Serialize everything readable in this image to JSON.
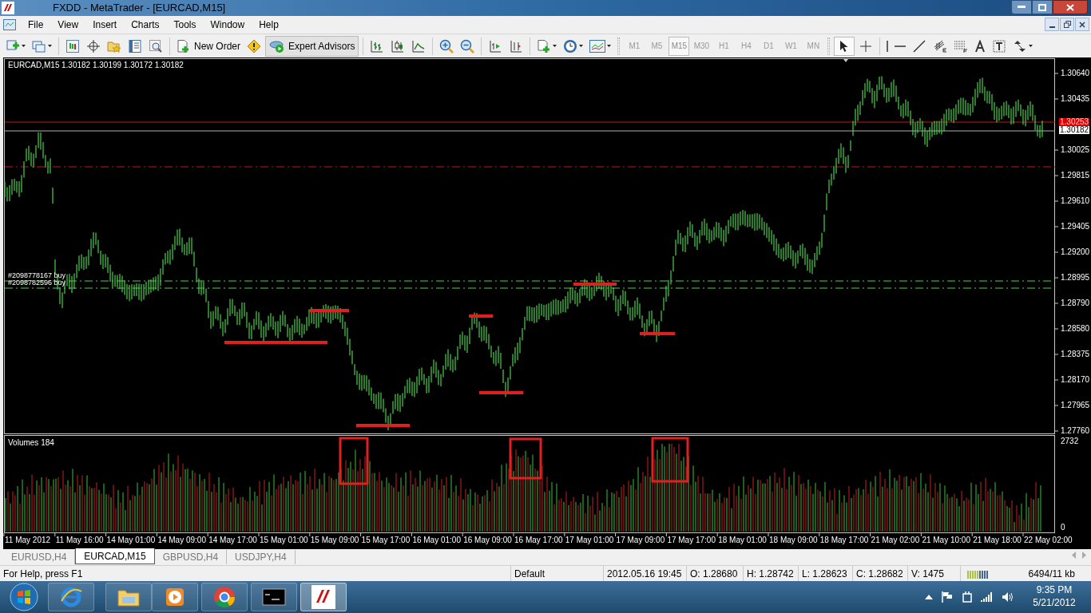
{
  "window": {
    "title": "FXDD - MetaTrader - [EURCAD,M15]"
  },
  "menu": [
    "File",
    "View",
    "Insert",
    "Charts",
    "Tools",
    "Window",
    "Help"
  ],
  "toolbar": {
    "new_order": "New Order",
    "expert_advisors": "Expert Advisors",
    "timeframes": [
      {
        "label": "M1",
        "selected": false
      },
      {
        "label": "M5",
        "selected": false
      },
      {
        "label": "M15",
        "selected": true
      },
      {
        "label": "M30",
        "selected": false
      },
      {
        "label": "H1",
        "selected": false
      },
      {
        "label": "H4",
        "selected": false
      },
      {
        "label": "D1",
        "selected": false
      },
      {
        "label": "W1",
        "selected": false
      },
      {
        "label": "MN",
        "selected": false
      }
    ]
  },
  "chart": {
    "symbol": "EURCAD,M15",
    "ohlc": "1.30182 1.30199 1.30172 1.30182",
    "price_labels": [
      "1.30640",
      "1.30435",
      "1.30025",
      "1.29815",
      "1.29610",
      "1.29405",
      "1.29200",
      "1.28995",
      "1.28790",
      "1.28580",
      "1.28375",
      "1.28170",
      "1.27965",
      "1.27760"
    ],
    "ask_label": "1.30253",
    "bid_label": "1.30182",
    "order_lines": [
      {
        "label": "#2098778167 buy"
      },
      {
        "label": "#2098782596 buy"
      }
    ],
    "volume_header": "Volumes 184",
    "volume_max": "2732",
    "volume_min": "0",
    "time_labels": [
      "11 May 2012",
      "11 May 16:00",
      "14 May 01:00",
      "14 May 09:00",
      "14 May 17:00",
      "15 May 01:00",
      "15 May 09:00",
      "15 May 17:00",
      "16 May 01:00",
      "16 May 09:00",
      "16 May 17:00",
      "17 May 01:00",
      "17 May 09:00",
      "17 May 17:00",
      "18 May 01:00",
      "18 May 09:00",
      "18 May 17:00",
      "21 May 02:00",
      "21 May 10:00",
      "21 May 18:00",
      "22 May 02:00"
    ]
  },
  "chart_tabs": [
    {
      "label": "EURUSD,H4",
      "selected": false
    },
    {
      "label": "EURCAD,M15",
      "selected": true
    },
    {
      "label": "GBPUSD,H4",
      "selected": false
    },
    {
      "label": "USDJPY,H4",
      "selected": false
    }
  ],
  "status_bar": {
    "help": "For Help, press F1",
    "profile": "Default",
    "time": "2012.05.16 19:45",
    "open": "O: 1.28680",
    "high": "H: 1.28742",
    "low": "L: 1.28623",
    "close": "C: 1.28682",
    "volume": "V: 1475",
    "traffic": "6494/11 kb"
  },
  "taskbar": {
    "clock_time": "9:35 PM",
    "clock_date": "5/21/2012"
  }
}
